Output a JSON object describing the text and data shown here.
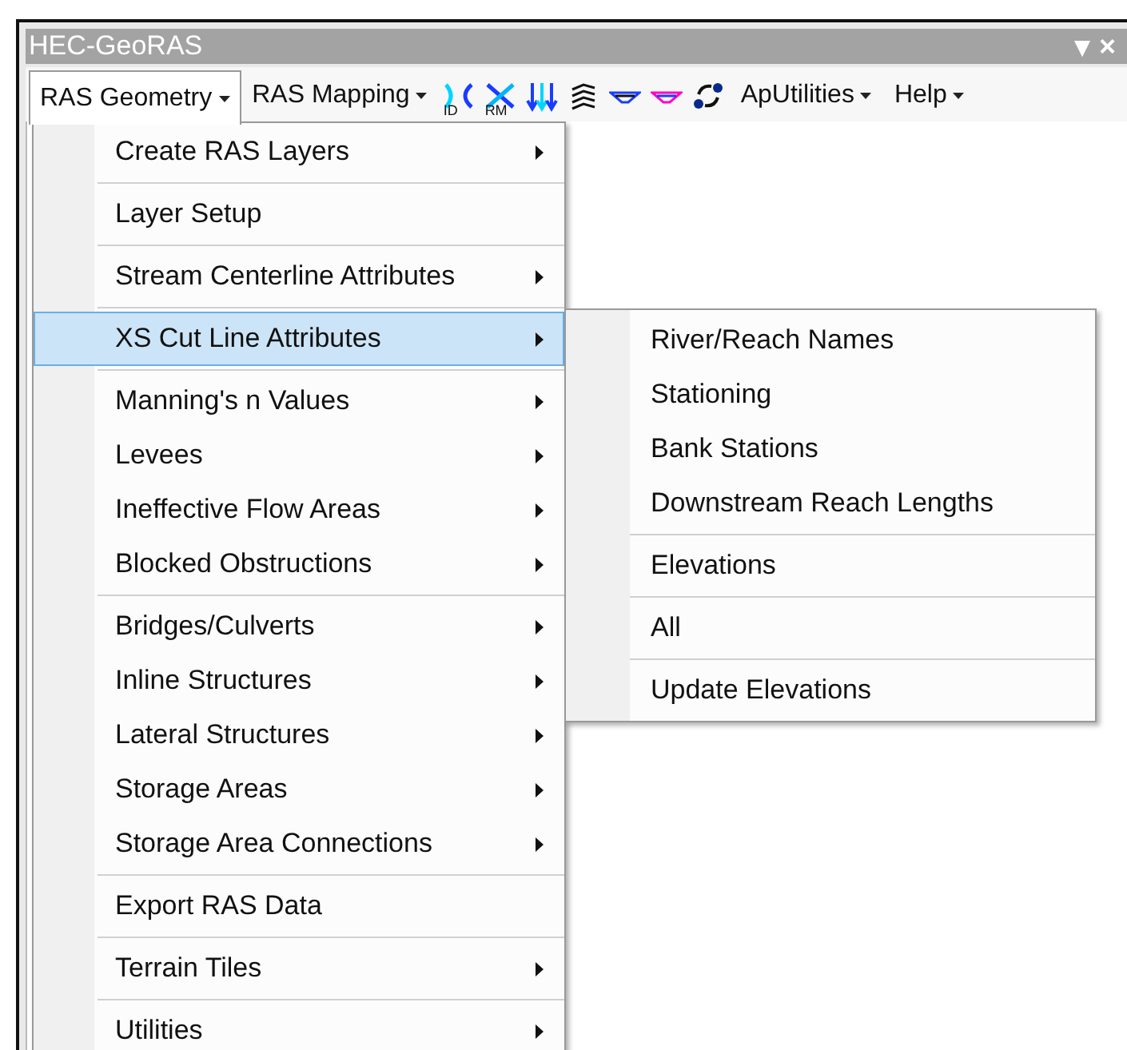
{
  "window": {
    "title": "HEC-GeoRAS",
    "controls": [
      "▾",
      "×"
    ]
  },
  "toolbar": {
    "menus_left": [
      {
        "label": "RAS Geometry",
        "selected": true
      },
      {
        "label": "RAS Mapping",
        "selected": false
      }
    ],
    "tools": [
      {
        "kind": "xs_id",
        "label": "ID"
      },
      {
        "kind": "xs_rm",
        "label": "RM"
      },
      {
        "kind": "arrows"
      },
      {
        "kind": "lines"
      },
      {
        "kind": "section"
      },
      {
        "kind": "section_pink"
      },
      {
        "kind": "sync"
      }
    ],
    "menus_right": [
      {
        "label": "ApUtilities",
        "selected": false
      },
      {
        "label": "Help",
        "selected": false
      }
    ]
  },
  "menu": {
    "groups": [
      [
        {
          "label": "Create RAS Layers",
          "submenu": true,
          "selected": false
        }
      ],
      [
        {
          "label": "Layer Setup",
          "submenu": false,
          "selected": false
        }
      ],
      [
        {
          "label": "Stream Centerline Attributes",
          "submenu": true,
          "selected": false
        }
      ],
      [
        {
          "label": "XS Cut Line Attributes",
          "submenu": true,
          "selected": true
        }
      ],
      [
        {
          "label": "Manning's n Values",
          "submenu": true,
          "selected": false
        },
        {
          "label": "Levees",
          "submenu": true,
          "selected": false
        },
        {
          "label": "Ineffective Flow Areas",
          "submenu": true,
          "selected": false
        },
        {
          "label": "Blocked Obstructions",
          "submenu": true,
          "selected": false
        }
      ],
      [
        {
          "label": "Bridges/Culverts",
          "submenu": true,
          "selected": false
        },
        {
          "label": "Inline Structures",
          "submenu": true,
          "selected": false
        },
        {
          "label": "Lateral Structures",
          "submenu": true,
          "selected": false
        },
        {
          "label": "Storage Areas",
          "submenu": true,
          "selected": false
        },
        {
          "label": "Storage Area Connections",
          "submenu": true,
          "selected": false
        }
      ],
      [
        {
          "label": "Export RAS Data",
          "submenu": false,
          "selected": false
        }
      ],
      [
        {
          "label": "Terrain Tiles",
          "submenu": true,
          "selected": false
        }
      ],
      [
        {
          "label": "Utilities",
          "submenu": true,
          "selected": false
        }
      ]
    ]
  },
  "submenu": {
    "groups": [
      [
        {
          "label": "River/Reach Names",
          "selected": false
        },
        {
          "label": "Stationing",
          "selected": false
        },
        {
          "label": "Bank Stations",
          "selected": false
        },
        {
          "label": "Downstream Reach Lengths",
          "selected": false
        }
      ],
      [
        {
          "label": "Elevations",
          "selected": false
        }
      ],
      [
        {
          "label": "All",
          "selected": false
        }
      ],
      [
        {
          "label": "Update Elevations",
          "selected": false
        }
      ]
    ]
  }
}
